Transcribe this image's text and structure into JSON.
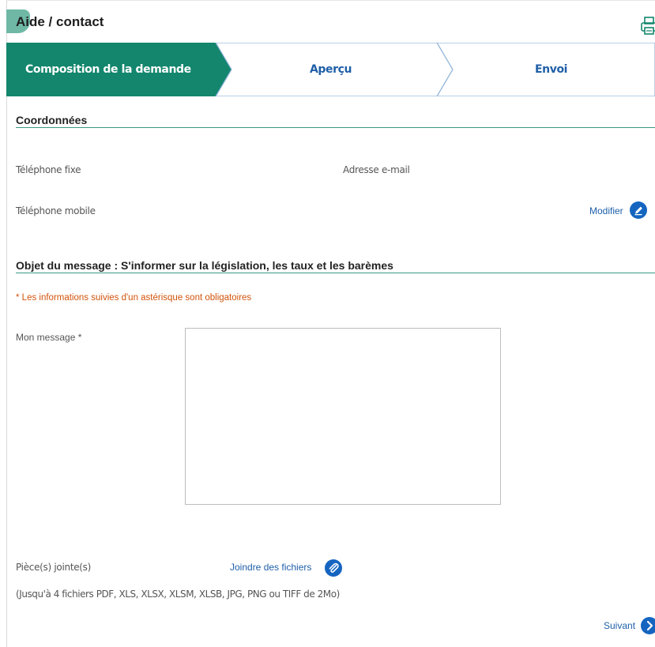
{
  "header": {
    "title": "Aide / contact",
    "print_icon": "printer-icon"
  },
  "stepper": {
    "steps": [
      {
        "label": "Composition de la demande",
        "state": "active"
      },
      {
        "label": "Aperçu",
        "state": "pending"
      },
      {
        "label": "Envoi",
        "state": "pending"
      }
    ],
    "active_color": "#13866d",
    "pending_color": "#ffffff",
    "outline_color": "#8fb3d9"
  },
  "coordonnees": {
    "title": "Coordonnées",
    "phone_fixed_label": "Téléphone fixe",
    "email_label": "Adresse e-mail",
    "phone_mobile_label": "Téléphone mobile",
    "modify_label": "Modifier",
    "modify_icon": "pencil-icon"
  },
  "objet": {
    "title": "Objet du message : S'informer sur la législation, les taux et les barèmes",
    "required_note": "* Les informations suivies d'un astérisque sont obligatoires",
    "message_label": "Mon message *",
    "message_value": ""
  },
  "attachments": {
    "label": "Pièce(s) jointe(s)",
    "attach_label": "Joindre des fichiers",
    "attach_icon": "paperclip-icon",
    "note": "(Jusqu'à 4 fichiers PDF, XLS, XLSX, XLSM, XLSB, JPG, PNG ou TIFF de 2Mo)"
  },
  "footer": {
    "next_label": "Suivant",
    "next_icon": "chevron-right-icon"
  },
  "colors": {
    "accent": "#13866d",
    "link": "#1e5fa8",
    "icon_blue": "#1565c0",
    "required": "#d2530b"
  }
}
